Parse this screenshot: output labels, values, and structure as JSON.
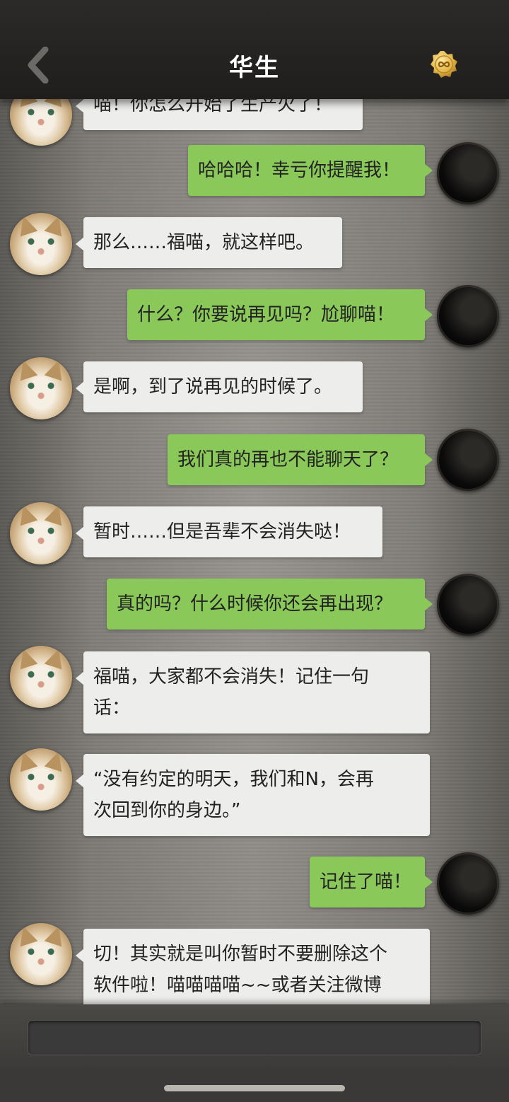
{
  "header": {
    "title": "华生",
    "back_icon": "chevron-left-icon",
    "action_icon": "infinity-coin-icon",
    "coin_color": "#e4b84a"
  },
  "messages": [
    {
      "from": "cat",
      "text": "喵！你怎么开始了生产火了！"
    },
    {
      "from": "me",
      "text": "哈哈哈！幸亏你提醒我！"
    },
    {
      "from": "cat",
      "text": "那么……福喵，就这样吧。"
    },
    {
      "from": "me",
      "text": "什么？你要说再见吗？尬聊喵！"
    },
    {
      "from": "cat",
      "text": "是啊，到了说再见的时候了。"
    },
    {
      "from": "me",
      "text": "我们真的再也不能聊天了？"
    },
    {
      "from": "cat",
      "text": "暂时……但是吾辈不会消失哒！"
    },
    {
      "from": "me",
      "text": "真的吗？什么时候你还会再出现？"
    },
    {
      "from": "cat",
      "text": "福喵，大家都不会消失！记住一句\n话："
    },
    {
      "from": "cat",
      "text": "“没有约定的明天，我们和N，会再\n次回到你的身边。”"
    },
    {
      "from": "me",
      "text": "记住了喵！"
    },
    {
      "from": "cat",
      "text": "切！其实就是叫你暂时不要删除这个\n软件啦！喵喵喵喵~~或者关注微博"
    }
  ],
  "colors": {
    "incoming_bubble": "#ededeb",
    "outgoing_bubble": "#8bc85a",
    "header_bg": "#2b2a28"
  },
  "input": {
    "value": ""
  }
}
